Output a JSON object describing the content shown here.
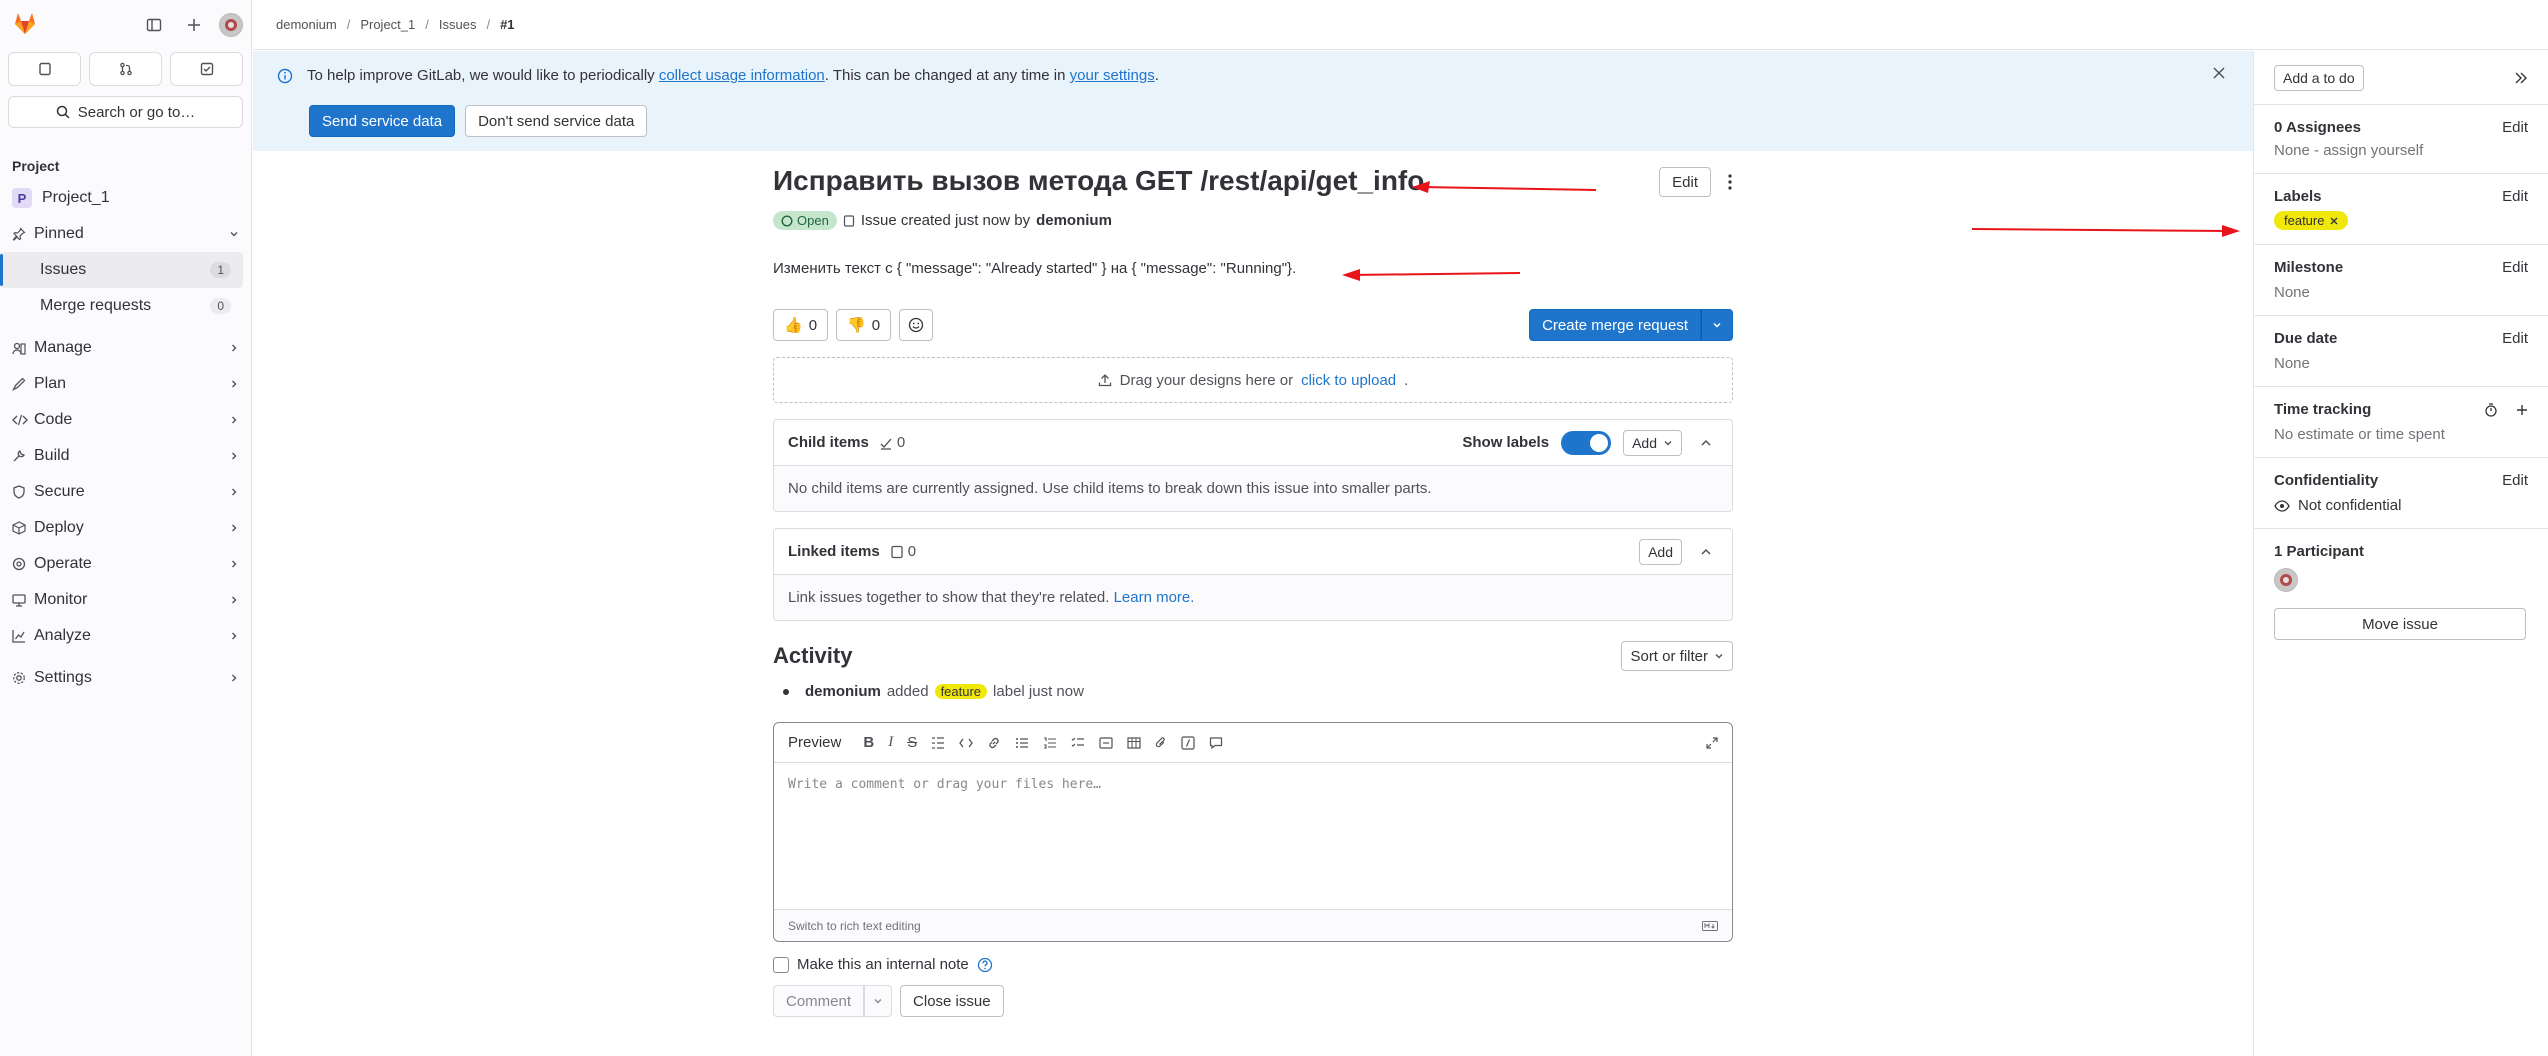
{
  "sidebar": {
    "search_label": "Search or go to…",
    "section_title": "Project",
    "project_name": "Project_1",
    "project_initial": "P",
    "pinned_label": "Pinned",
    "pinned_items": [
      {
        "label": "Issues",
        "count": "1"
      },
      {
        "label": "Merge requests",
        "count": "0"
      }
    ],
    "nav": [
      {
        "label": "Manage",
        "icon": "manage-icon"
      },
      {
        "label": "Plan",
        "icon": "plan-icon"
      },
      {
        "label": "Code",
        "icon": "code-icon"
      },
      {
        "label": "Build",
        "icon": "build-icon"
      },
      {
        "label": "Secure",
        "icon": "shield-icon"
      },
      {
        "label": "Deploy",
        "icon": "deploy-icon"
      },
      {
        "label": "Operate",
        "icon": "operate-icon"
      },
      {
        "label": "Monitor",
        "icon": "monitor-icon"
      },
      {
        "label": "Analyze",
        "icon": "analyze-icon"
      }
    ],
    "settings_label": "Settings"
  },
  "breadcrumb": [
    "demonium",
    "Project_1",
    "Issues",
    "#1"
  ],
  "banner": {
    "text_before": "To help improve GitLab, we would like to periodically ",
    "link1": "collect usage information",
    "text_middle": ". This can be changed at any time in ",
    "link2": "your settings",
    "text_after": ".",
    "send_button": "Send service data",
    "dont_send_button": "Don't send service data"
  },
  "issue": {
    "title": "Исправить вызов метода GET /rest/api/get_info",
    "edit_button": "Edit",
    "status": "Open",
    "meta_text": "Issue created just now by",
    "author": "demonium",
    "description": "Изменить текст с { \"message\": \"Already started\" } на { \"message\": \"Running\"}.",
    "thumbs_up": "0",
    "thumbs_down": "0",
    "create_mr_button": "Create merge request",
    "dropzone_text": "Drag your designs here or",
    "dropzone_link": "click to upload",
    "child_items": {
      "title": "Child items",
      "count": "0",
      "show_labels": "Show labels",
      "add_button": "Add",
      "empty_text": "No child items are currently assigned. Use child items to break down this issue into smaller parts."
    },
    "linked_items": {
      "title": "Linked items",
      "count": "0",
      "add_button": "Add",
      "empty_text": "Link issues together to show that they're related.",
      "learn_more": "Learn more."
    }
  },
  "activity": {
    "title": "Activity",
    "sort_button": "Sort or filter",
    "note_user": "demonium",
    "note_action": "added",
    "note_label": "feature",
    "note_suffix": "label just now",
    "editor_tab": "Preview",
    "editor_placeholder": "Write a comment or drag your files here…",
    "switch_text": "Switch to rich text editing",
    "internal_note": "Make this an internal note",
    "comment_button": "Comment",
    "close_button": "Close issue"
  },
  "right_sidebar": {
    "todo_button": "Add a to do",
    "assignees_title": "0 Assignees",
    "assignees_value": "None - assign yourself",
    "labels_title": "Labels",
    "label_name": "feature",
    "milestone_title": "Milestone",
    "milestone_value": "None",
    "due_title": "Due date",
    "due_value": "None",
    "time_title": "Time tracking",
    "time_value": "No estimate or time spent",
    "conf_title": "Confidentiality",
    "conf_value": "Not confidential",
    "participants_title": "1 Participant",
    "move_button": "Move issue",
    "edit_label": "Edit"
  },
  "colors": {
    "accent": "#1f75cb",
    "label_yellow": "#f0e80a",
    "arrow_red": "#e8141a",
    "open_badge_bg": "#c3e6cd"
  }
}
